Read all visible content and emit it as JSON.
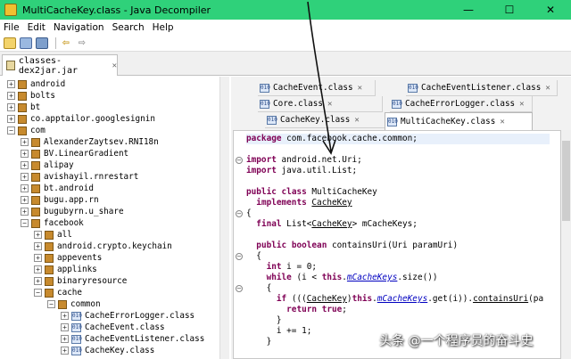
{
  "window": {
    "title": "MultiCacheKey.class - Java Decompiler",
    "minimize": "—",
    "maximize": "☐",
    "close": "✕"
  },
  "menu": [
    "File",
    "Edit",
    "Navigation",
    "Search",
    "Help"
  ],
  "file_tab": {
    "label": "classes-dex2jar.jar"
  },
  "tree": {
    "items": [
      {
        "label": "android",
        "type": "package",
        "expanded": false,
        "depth": 0
      },
      {
        "label": "bolts",
        "type": "package",
        "expanded": false,
        "depth": 0
      },
      {
        "label": "bt",
        "type": "package",
        "expanded": false,
        "depth": 0
      },
      {
        "label": "co.apptailor.googlesignin",
        "type": "package",
        "expanded": false,
        "depth": 0
      },
      {
        "label": "com",
        "type": "package",
        "expanded": true,
        "depth": 0
      },
      {
        "label": "AlexanderZaytsev.RNI18n",
        "type": "package",
        "expanded": false,
        "depth": 1
      },
      {
        "label": "BV.LinearGradient",
        "type": "package",
        "expanded": false,
        "depth": 1
      },
      {
        "label": "alipay",
        "type": "package",
        "expanded": false,
        "depth": 1
      },
      {
        "label": "avishayil.rnrestart",
        "type": "package",
        "expanded": false,
        "depth": 1
      },
      {
        "label": "bt.android",
        "type": "package",
        "expanded": false,
        "depth": 1
      },
      {
        "label": "bugu.app.rn",
        "type": "package",
        "expanded": false,
        "depth": 1
      },
      {
        "label": "bugubyrn.u_share",
        "type": "package",
        "expanded": false,
        "depth": 1
      },
      {
        "label": "facebook",
        "type": "package",
        "expanded": true,
        "depth": 1
      },
      {
        "label": "all",
        "type": "package",
        "expanded": false,
        "depth": 2
      },
      {
        "label": "android.crypto.keychain",
        "type": "package",
        "expanded": false,
        "depth": 2
      },
      {
        "label": "appevents",
        "type": "package",
        "expanded": false,
        "depth": 2
      },
      {
        "label": "applinks",
        "type": "package",
        "expanded": false,
        "depth": 2
      },
      {
        "label": "binaryresource",
        "type": "package",
        "expanded": false,
        "depth": 2
      },
      {
        "label": "cache",
        "type": "package",
        "expanded": true,
        "depth": 2
      },
      {
        "label": "common",
        "type": "package",
        "expanded": true,
        "depth": 3
      },
      {
        "label": "CacheErrorLogger.class",
        "type": "class",
        "expanded": false,
        "depth": 4
      },
      {
        "label": "CacheEvent.class",
        "type": "class",
        "expanded": false,
        "depth": 4
      },
      {
        "label": "CacheEventListener.class",
        "type": "class",
        "expanded": false,
        "depth": 4
      },
      {
        "label": "CacheKey.class",
        "type": "class",
        "expanded": false,
        "depth": 4
      }
    ]
  },
  "code_tabs": {
    "row1": [
      {
        "label": "CacheEvent.class"
      },
      {
        "label": "CacheEventListener.class"
      }
    ],
    "row2": [
      {
        "label": "Core.class"
      },
      {
        "label": "CacheErrorLogger.class"
      }
    ],
    "row3": [
      {
        "label": "CacheKey.class"
      },
      {
        "label": "MultiCacheKey.class",
        "active": true
      }
    ]
  },
  "code": {
    "l1_kw": "package",
    "l1_rest": " com.facebook.cache.common;",
    "l2_kw": "import",
    "l2_rest": " android.net.Uri;",
    "l3_kw": "import",
    "l3_rest": " java.util.List;",
    "l4_kw1": "public",
    "l4_kw2": "class",
    "l4_rest": " MultiCacheKey",
    "l5_kw": "implements",
    "l5_type": "CacheKey",
    "l6": "{",
    "l7_kw": "final",
    "l7_a": " List<",
    "l7_type": "CacheKey",
    "l7_b": "> mCacheKeys;",
    "l8_kw1": "public",
    "l8_kw2": "boolean",
    "l8_rest": " containsUri(Uri paramUri)",
    "l9": "{",
    "l10_kw": "int",
    "l10_rest": " i = 0;",
    "l11_kw": "while",
    "l11_a": " (i < ",
    "l11_kw2": "this",
    "l11_b": ".",
    "l11_fld": "mCacheKeys",
    "l11_c": ".size())",
    "l12": "{",
    "l13_kw": "if",
    "l13_a": " (((",
    "l13_type": "CacheKey",
    "l13_b": ")",
    "l13_kw2": "this",
    "l13_c": ".",
    "l13_fld": "mCacheKeys",
    "l13_d": ".get(i)).",
    "l13_m": "containsUri",
    "l13_e": "(pa",
    "l14_kw1": "return",
    "l14_kw2": "true",
    "l14_rest": ";",
    "l15": "}",
    "l16": "i += 1;",
    "l17": "}"
  },
  "watermark": "头条 @一个程序员的奋斗史"
}
